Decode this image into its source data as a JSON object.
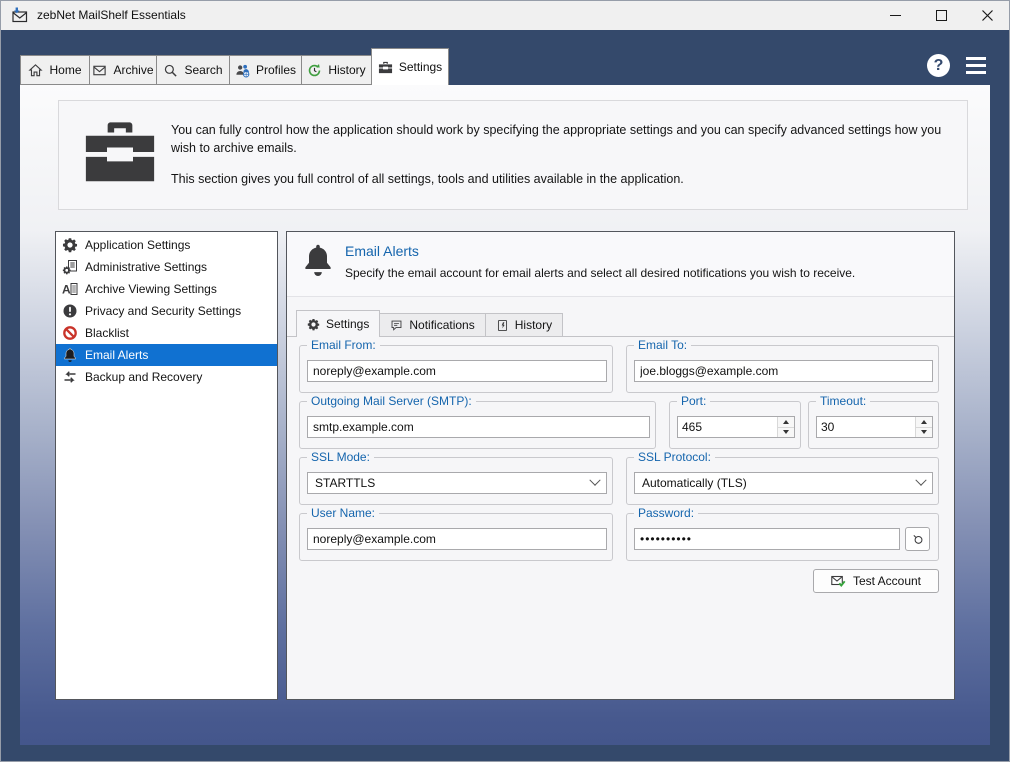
{
  "window": {
    "title": "zebNet MailShelf Essentials"
  },
  "nav": {
    "tabs": [
      "Home",
      "Archive",
      "Search",
      "Profiles",
      "History",
      "Settings"
    ],
    "active_tab": "Settings"
  },
  "topbar": {
    "help_glyph": "?"
  },
  "header": {
    "line1": "You can fully control how the application should work by specifying the appropriate settings and you can specify advanced settings how you wish to archive emails.",
    "line2": "This section gives you full control of all settings, tools and utilities available in the application."
  },
  "sidebar": {
    "items": [
      "Application Settings",
      "Administrative Settings",
      "Archive Viewing Settings",
      "Privacy and Security Settings",
      "Blacklist",
      "Email Alerts",
      "Backup and Recovery"
    ],
    "selected": "Email Alerts"
  },
  "panel": {
    "title": "Email Alerts",
    "subtitle": "Specify the email account for email alerts and select all desired notifications you wish to receive.",
    "tabs": [
      "Settings",
      "Notifications",
      "History"
    ],
    "active_tab": "Settings",
    "form": {
      "email_from": {
        "label": "Email From:",
        "value": "noreply@example.com"
      },
      "email_to": {
        "label": "Email To:",
        "value": "joe.bloggs@example.com"
      },
      "smtp_server": {
        "label": "Outgoing Mail Server (SMTP):",
        "value": "smtp.example.com"
      },
      "port": {
        "label": "Port:",
        "value": "465"
      },
      "timeout": {
        "label": "Timeout:",
        "value": "30"
      },
      "ssl_mode": {
        "label": "SSL Mode:",
        "value": "STARTTLS"
      },
      "ssl_protocol": {
        "label": "SSL Protocol:",
        "value": "Automatically (TLS)"
      },
      "user_name": {
        "label": "User Name:",
        "value": "noreply@example.com"
      },
      "password": {
        "label": "Password:",
        "value": "••••••••••"
      },
      "test_account_label": "Test Account"
    }
  },
  "colors": {
    "titlebar_bg": "#f0f0f0",
    "frame_navy": "#34496b",
    "gradient_bottom": "#44568c",
    "selection_blue": "#1071d1",
    "label_blue": "#1565ad",
    "blacklist_red": "#c9342a",
    "history_green": "#3f9e3f",
    "check_green": "#36a43c",
    "profiles_blue": "#2e6fbd"
  }
}
